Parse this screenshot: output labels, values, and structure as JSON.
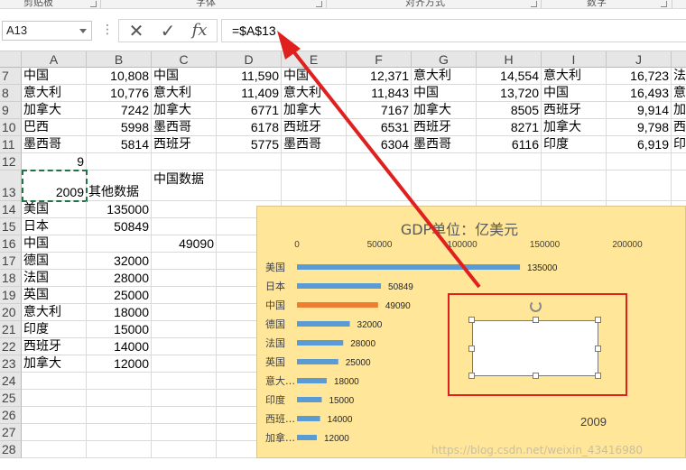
{
  "ribbon": {
    "groups": [
      "剪贴板",
      "字体",
      "对齐方式",
      "数字"
    ]
  },
  "formula_bar": {
    "name_box": "A13",
    "menu_dots": "⋮",
    "cancel_glyph": "✕",
    "enter_glyph": "✓",
    "fx_label": "fx",
    "formula": "=$A$13"
  },
  "columns": [
    "A",
    "B",
    "C",
    "D",
    "E",
    "F",
    "G",
    "H",
    "I",
    "J"
  ],
  "rows": [
    {
      "num": "7",
      "cells": [
        "中国",
        "10,808",
        "中国",
        "11,590",
        "中国",
        "12,371",
        "意大利",
        "14,554",
        "意大利",
        "16,723",
        "法"
      ]
    },
    {
      "num": "8",
      "cells": [
        "意大利",
        "10,776",
        "意大利",
        "11,409",
        "意大利",
        "11,843",
        "中国",
        "13,720",
        "中国",
        "16,493",
        "意"
      ]
    },
    {
      "num": "9",
      "cells": [
        "加拿大",
        "7242",
        "加拿大",
        "6771",
        "加拿大",
        "7167",
        "加拿大",
        "8505",
        "西班牙",
        "9,914",
        "加"
      ]
    },
    {
      "num": "10",
      "cells": [
        "巴西",
        "5998",
        "墨西哥",
        "6178",
        "西班牙",
        "6531",
        "西班牙",
        "8271",
        "加拿大",
        "9,798",
        "西"
      ]
    },
    {
      "num": "11",
      "cells": [
        "墨西哥",
        "5814",
        "西班牙",
        "5775",
        "墨西哥",
        "6304",
        "墨西哥",
        "6116",
        "印度",
        "6,919",
        "印"
      ]
    },
    {
      "num": "12",
      "cells": [
        "9",
        "",
        "",
        "",
        "",
        "",
        "",
        "",
        "",
        "",
        ""
      ]
    },
    {
      "num": "13",
      "cells": [
        "2009",
        "其他数据",
        "中国数据",
        "",
        "",
        "",
        "",
        "",
        "",
        "",
        ""
      ]
    },
    {
      "num": "14",
      "cells": [
        "美国",
        "135000",
        "",
        "",
        "",
        "",
        "",
        "",
        "",
        "",
        ""
      ]
    },
    {
      "num": "15",
      "cells": [
        "日本",
        "50849",
        "",
        "",
        "",
        "",
        "",
        "",
        "",
        "",
        ""
      ]
    },
    {
      "num": "16",
      "cells": [
        "中国",
        "",
        "49090",
        "",
        "",
        "",
        "",
        "",
        "",
        "",
        ""
      ]
    },
    {
      "num": "17",
      "cells": [
        "德国",
        "32000",
        "",
        "",
        "",
        "",
        "",
        "",
        "",
        "",
        ""
      ]
    },
    {
      "num": "18",
      "cells": [
        "法国",
        "28000",
        "",
        "",
        "",
        "",
        "",
        "",
        "",
        "",
        ""
      ]
    },
    {
      "num": "19",
      "cells": [
        "英国",
        "25000",
        "",
        "",
        "",
        "",
        "",
        "",
        "",
        "",
        ""
      ]
    },
    {
      "num": "20",
      "cells": [
        "意大利",
        "18000",
        "",
        "",
        "",
        "",
        "",
        "",
        "",
        "",
        ""
      ]
    },
    {
      "num": "21",
      "cells": [
        "印度",
        "15000",
        "",
        "",
        "",
        "",
        "",
        "",
        "",
        "",
        ""
      ]
    },
    {
      "num": "22",
      "cells": [
        "西班牙",
        "14000",
        "",
        "",
        "",
        "",
        "",
        "",
        "",
        "",
        ""
      ]
    },
    {
      "num": "23",
      "cells": [
        "加拿大",
        "12000",
        "",
        "",
        "",
        "",
        "",
        "",
        "",
        "",
        ""
      ]
    },
    {
      "num": "24",
      "cells": [
        "",
        "",
        "",
        "",
        "",
        "",
        "",
        "",
        "",
        "",
        ""
      ]
    },
    {
      "num": "25",
      "cells": [
        "",
        "",
        "",
        "",
        "",
        "",
        "",
        "",
        "",
        "",
        ""
      ]
    },
    {
      "num": "26",
      "cells": [
        "",
        "",
        "",
        "",
        "",
        "",
        "",
        "",
        "",
        "",
        ""
      ]
    },
    {
      "num": "27",
      "cells": [
        "",
        "",
        "",
        "",
        "",
        "",
        "",
        "",
        "",
        "",
        ""
      ]
    },
    {
      "num": "28",
      "cells": [
        "",
        "",
        "",
        "",
        "",
        "",
        "",
        "",
        "",
        "",
        ""
      ]
    }
  ],
  "chart_data": {
    "type": "bar",
    "orientation": "horizontal",
    "title": "GDP单位：亿美元",
    "categories": [
      "美国",
      "日本",
      "中国",
      "德国",
      "法国",
      "英国",
      "意大…",
      "印度",
      "西班…",
      "加拿…"
    ],
    "values": [
      135000,
      50849,
      49090,
      32000,
      28000,
      25000,
      18000,
      15000,
      14000,
      12000
    ],
    "data_labels": [
      "135000",
      "50849",
      "49090",
      "32000",
      "28000",
      "25000",
      "18000",
      "15000",
      "14000",
      "12000"
    ],
    "highlight": [
      false,
      false,
      true,
      false,
      false,
      false,
      false,
      false,
      false,
      false
    ],
    "xlim": [
      0,
      200000
    ],
    "xticks": [
      0,
      50000,
      100000,
      150000,
      200000
    ],
    "xtick_labels": [
      "0",
      "50000",
      "100000",
      "150000",
      "200000"
    ],
    "axis_position": "top",
    "grid": false,
    "legend": "none",
    "bar_color": "#5b9bd5",
    "highlight_color": "#ed7d31",
    "background": "#ffe699",
    "linked_label": "2009"
  },
  "annotation": {
    "color": "#e0201f"
  },
  "watermark": "https://blog.csdn.net/weixin_43416980"
}
